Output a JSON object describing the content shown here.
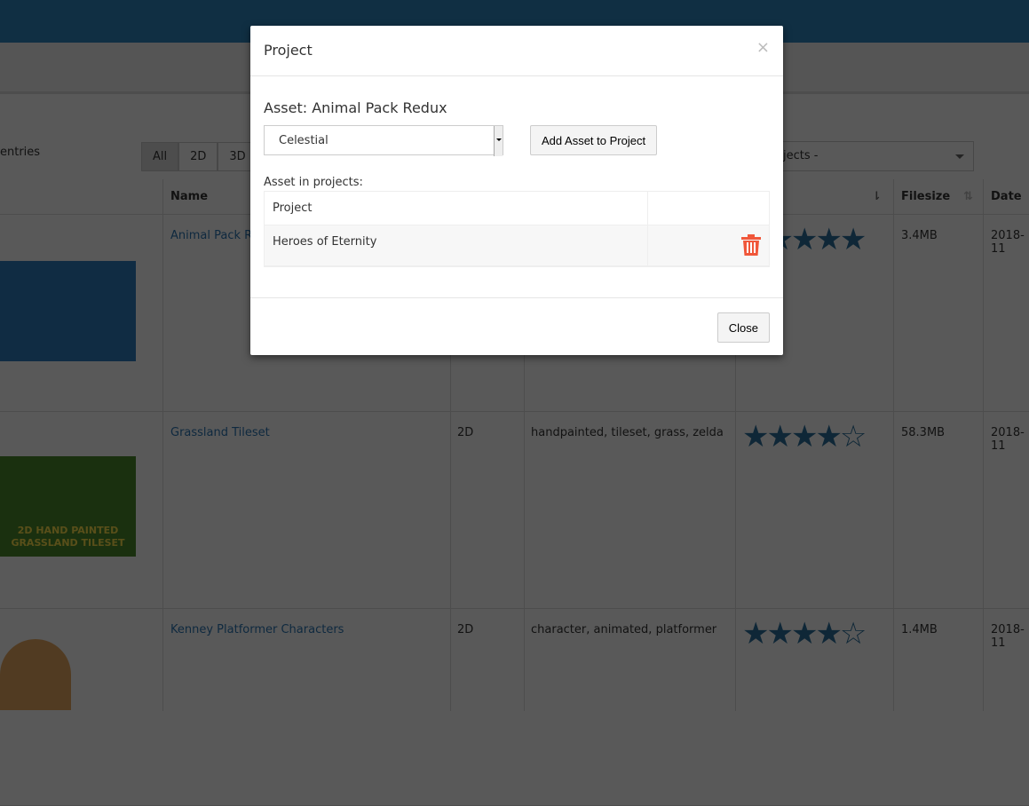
{
  "background": {
    "entries_label": "entries",
    "filters": [
      "All",
      "2D",
      "3D"
    ],
    "project_filter": "l projects -",
    "columns": {
      "name": "Name",
      "filesize": "Filesize",
      "date": "Date"
    },
    "rows": [
      {
        "name": "Animal Pack Re",
        "type": "",
        "tags": "",
        "rating": 5,
        "stars": "★★★★★",
        "filesize": "3.4MB",
        "date": "2018-11"
      },
      {
        "name": "Grassland Tileset",
        "type": "2D",
        "tags": "handpainted, tileset, grass, zelda",
        "rating": 4.5,
        "stars": "★★★★☆",
        "filesize": "58.3MB",
        "date": "2018-11",
        "thumb_text": "2D HAND PAINTED GRASSLAND TILESET"
      },
      {
        "name": "Kenney Platformer Characters",
        "type": "2D",
        "tags": "character, animated, platformer",
        "rating": 4.5,
        "stars": "★★★★☆",
        "filesize": "1.4MB",
        "date": "2018-11"
      }
    ]
  },
  "modal": {
    "title": "Project",
    "close_x": "×",
    "asset_label": "Asset: Animal Pack Redux",
    "project_select": "Celestial",
    "add_button": "Add Asset to Project",
    "in_projects_label": "Asset in projects:",
    "table_header": "Project",
    "projects": [
      "Heroes of Eternity"
    ],
    "close_button": "Close"
  },
  "colors": {
    "trash": "#f0573a",
    "accent": "#2f86c0"
  }
}
